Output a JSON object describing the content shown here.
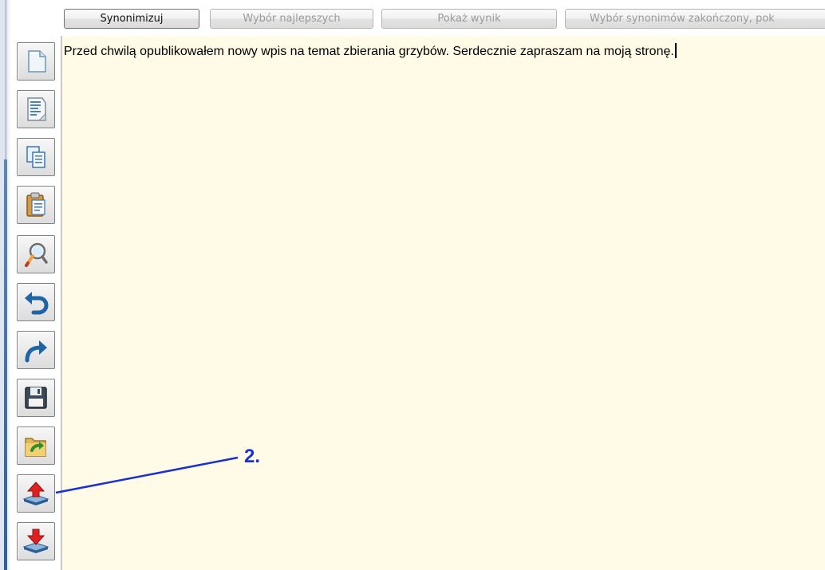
{
  "top_buttons": [
    {
      "label": "Synonimizuj",
      "state": "active"
    },
    {
      "label": "Wybór najlepszych",
      "state": "disabled"
    },
    {
      "label": "Pokaż wynik",
      "state": "disabled"
    },
    {
      "label": "Wybór synonimów zakończony, pok",
      "state": "disabled"
    }
  ],
  "toolbar": {
    "icons": [
      "new-document-icon",
      "text-document-icon",
      "copy-icon",
      "paste-icon",
      "find-replace-icon",
      "undo-icon",
      "redo-icon",
      "save-icon",
      "open-folder-icon",
      "upload-icon",
      "download-icon"
    ]
  },
  "editor": {
    "text": "Przed chwilą opublikowałem nowy wpis na temat zbierania grzybów. Serdecznie zapraszam na moją stronę."
  },
  "annotation": {
    "label": "2.",
    "color": "#1a2fd6",
    "points_to": "upload-icon"
  },
  "colors": {
    "editor_background": "#fffbe6",
    "annotation": "#1a2fd6"
  }
}
